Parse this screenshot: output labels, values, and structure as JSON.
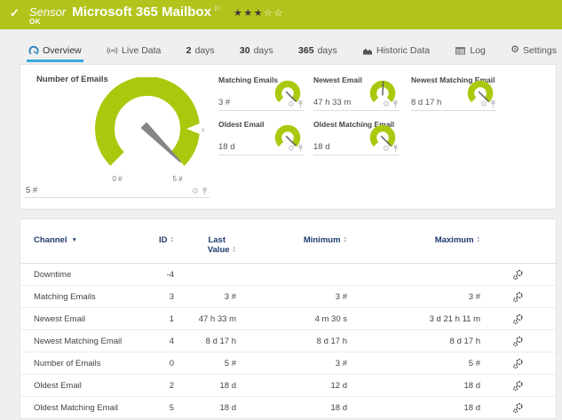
{
  "header": {
    "type_label": "Sensor",
    "title": "Microsoft 365 Mailbox",
    "status": "OK",
    "priority_filled": 3,
    "priority_total": 5
  },
  "tabs": [
    {
      "id": "overview",
      "label": "Overview",
      "icon": "gauge-icon",
      "active": true
    },
    {
      "id": "live-data",
      "label": "Live Data",
      "icon": "live-signal-icon",
      "active": false
    },
    {
      "id": "2-days",
      "num": "2",
      "label": "days",
      "active": false
    },
    {
      "id": "30-days",
      "num": "30",
      "label": "days",
      "active": false
    },
    {
      "id": "365-days",
      "num": "365",
      "label": "days",
      "active": false
    },
    {
      "id": "historic-data",
      "label": "Historic Data",
      "icon": "area-chart-icon",
      "active": false
    },
    {
      "id": "log",
      "label": "Log",
      "icon": "log-table-icon",
      "active": false
    },
    {
      "id": "settings",
      "label": "Settings",
      "icon": "gear-icon",
      "active": false
    }
  ],
  "main_gauge": {
    "title": "Number of Emails",
    "value": "5 #",
    "scale_min_label": "0 #",
    "scale_max_label": "5 #",
    "marker_label": "x",
    "fraction": 1
  },
  "mini_gauges": [
    {
      "title": "Matching Emails",
      "value": "3 #",
      "fraction": 1,
      "row": 1,
      "col": 1
    },
    {
      "title": "Newest Email",
      "value": "47 h 33 m",
      "fraction": 0.51,
      "row": 1,
      "col": 2
    },
    {
      "title": "Newest Matching Email",
      "value": "8 d 17 h",
      "fraction": 1,
      "row": 1,
      "col": 3
    },
    {
      "title": "Oldest Email",
      "value": "18 d",
      "fraction": 1,
      "row": 2,
      "col": 1
    },
    {
      "title": "Oldest Matching Email",
      "value": "18 d",
      "fraction": 1,
      "row": 2,
      "col": 2
    }
  ],
  "table": {
    "headers": [
      {
        "label": "Channel",
        "sort": "desc-active"
      },
      {
        "label": "ID",
        "sort": "both"
      },
      {
        "label": "Last Value",
        "sort": "both",
        "two_line": [
          "Last",
          "Value"
        ]
      },
      {
        "label": "Minimum",
        "sort": "both"
      },
      {
        "label": "Maximum",
        "sort": "both"
      }
    ],
    "rows": [
      {
        "channel": "Downtime",
        "id": "-4",
        "last": "",
        "min": "",
        "max": ""
      },
      {
        "channel": "Matching Emails",
        "id": "3",
        "last": "3 #",
        "min": "3 #",
        "max": "3 #"
      },
      {
        "channel": "Newest Email",
        "id": "1",
        "last": "47 h 33 m",
        "min": "4 m 30 s",
        "max": "3 d 21 h 11 m"
      },
      {
        "channel": "Newest Matching Email",
        "id": "4",
        "last": "8 d 17 h",
        "min": "8 d 17 h",
        "max": "8 d 17 h"
      },
      {
        "channel": "Number of Emails",
        "id": "0",
        "last": "5 #",
        "min": "3 #",
        "max": "5 #"
      },
      {
        "channel": "Oldest Email",
        "id": "2",
        "last": "18 d",
        "min": "12 d",
        "max": "18 d"
      },
      {
        "channel": "Oldest Matching Email",
        "id": "5",
        "last": "18 d",
        "min": "18 d",
        "max": "18 d"
      }
    ]
  },
  "colors": {
    "status_green": "#b2c31c",
    "gauge_green": "#a9c90f",
    "tab_active_blue": "#38a9da",
    "table_header_navy": "#1e3a6e"
  }
}
